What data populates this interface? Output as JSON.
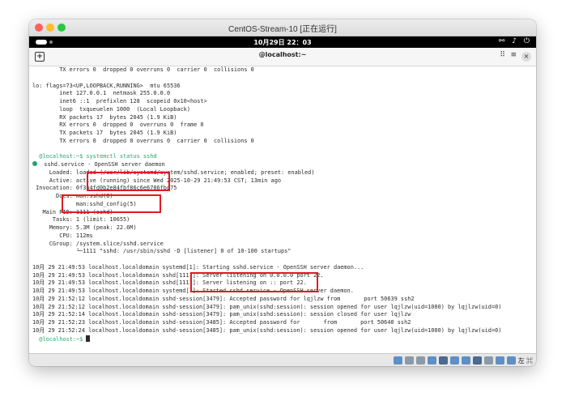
{
  "window": {
    "title": "CentOS-Stream-10 [正在运行]"
  },
  "topbar": {
    "clock": "10月29日 22：03",
    "icons": [
      "network-icon",
      "volume-icon",
      "power-icon"
    ]
  },
  "header": {
    "tab_title": "@localhost:~",
    "new_tab_icon": "+",
    "grid_icon": "⠿",
    "menu_icon": "≡",
    "close_icon": "×"
  },
  "terminal": {
    "lines": [
      {
        "t": "        TX errors 0  dropped 0 overruns 0  carrier 0  collisions 0"
      },
      {
        "t": ""
      },
      {
        "t": "lo: flags=73<UP,LOOPBACK,RUNNING>  mtu 65536"
      },
      {
        "t": "        inet 127.0.0.1  netmask 255.0.0.0"
      },
      {
        "t": "        inet6 ::1  prefixlen 128  scopeid 0x10<host>"
      },
      {
        "t": "        loop  txqueuelen 1000  (Local Loopback)"
      },
      {
        "t": "        RX packets 17  bytes 2045 (1.9 KiB)"
      },
      {
        "t": "        RX errors 0  dropped 0  overruns 0  frame 0"
      },
      {
        "t": "        TX packets 17  bytes 2045 (1.9 KiB)"
      },
      {
        "t": "        TX errors 0  dropped 0 overruns 0  carrier 0  collisions 0"
      },
      {
        "t": ""
      },
      {
        "t": "  @localhost:~$ systemctl status sshd",
        "cls": "green"
      },
      {
        "t": "  sshd.service - OpenSSH server daemon",
        "dot": true
      },
      {
        "t": "     Loaded: loaded (/usr/lib/systemd/system/sshd.service; enabled; preset: enabled)"
      },
      {
        "t": "     Active: active (running) since Wed 2025-10-29 21:49:53 CST; 13min ago"
      },
      {
        "t": " Invocation: 0f3b4fd0b2e84fbf86c6e6706fbd75"
      },
      {
        "t": "       Docs: man:sshd(8)"
      },
      {
        "t": "             man:sshd_config(5)"
      },
      {
        "t": "   Main PID: 1111 (sshd)"
      },
      {
        "t": "      Tasks: 1 (limit: 10655)"
      },
      {
        "t": "     Memory: 5.3M (peak: 22.6M)"
      },
      {
        "t": "        CPU: 112ms"
      },
      {
        "t": "     CGroup: /system.slice/sshd.service"
      },
      {
        "t": "             └─1111 \"sshd: /usr/sbin/sshd -D [listener] 0 of 10-100 startups\""
      },
      {
        "t": ""
      },
      {
        "t": "10月 29 21:49:53 localhost.localdomain systemd[1]: Starting sshd.service - OpenSSH server daemon..."
      },
      {
        "t": "10月 29 21:49:53 localhost.localdomain sshd[1111]: Server listening on 0.0.0.0 port 22."
      },
      {
        "t": "10月 29 21:49:53 localhost.localdomain sshd[1111]: Server listening on :: port 22."
      },
      {
        "t": "10月 29 21:49:53 localhost.localdomain systemd[1]: Started sshd.service - OpenSSH server daemon."
      },
      {
        "t": "10月 29 21:52:12 localhost.localdomain sshd-session[3479]: Accepted password for lqjlzw from       port 50639 ssh2"
      },
      {
        "t": "10月 29 21:52:12 localhost.localdomain sshd-session[3479]: pam_unix(sshd:session): session opened for user lqjlzw(uid=1000) by lqjlzw(uid=0)"
      },
      {
        "t": "10月 29 21:52:14 localhost.localdomain sshd-session[3479]: pam_unix(sshd:session): session closed for user lqjlzw"
      },
      {
        "t": "10月 29 21:52:23 localhost.localdomain sshd-session[3485]: Accepted password for       from       port 50640 ssh2"
      },
      {
        "t": "10月 29 21:52:24 localhost.localdomain sshd-session[3485]: pam_unix(sshd:session): session opened for user lqjlzw(uid=1000) by lqjlzw(uid=0)"
      },
      {
        "t": "  @localhost:~$ ",
        "cls": "green",
        "cursor": true
      }
    ]
  },
  "statusbar": {
    "right_text": "左 ⌘",
    "icons": [
      "disk-icon",
      "optical-icon",
      "usb-icon",
      "audio-icon",
      "network-icon",
      "shared-folder-icon",
      "display-icon",
      "record-icon",
      "cpu-icon",
      "mouse-icon",
      "download-icon"
    ]
  },
  "highlights": {
    "color": "#e01b24"
  }
}
